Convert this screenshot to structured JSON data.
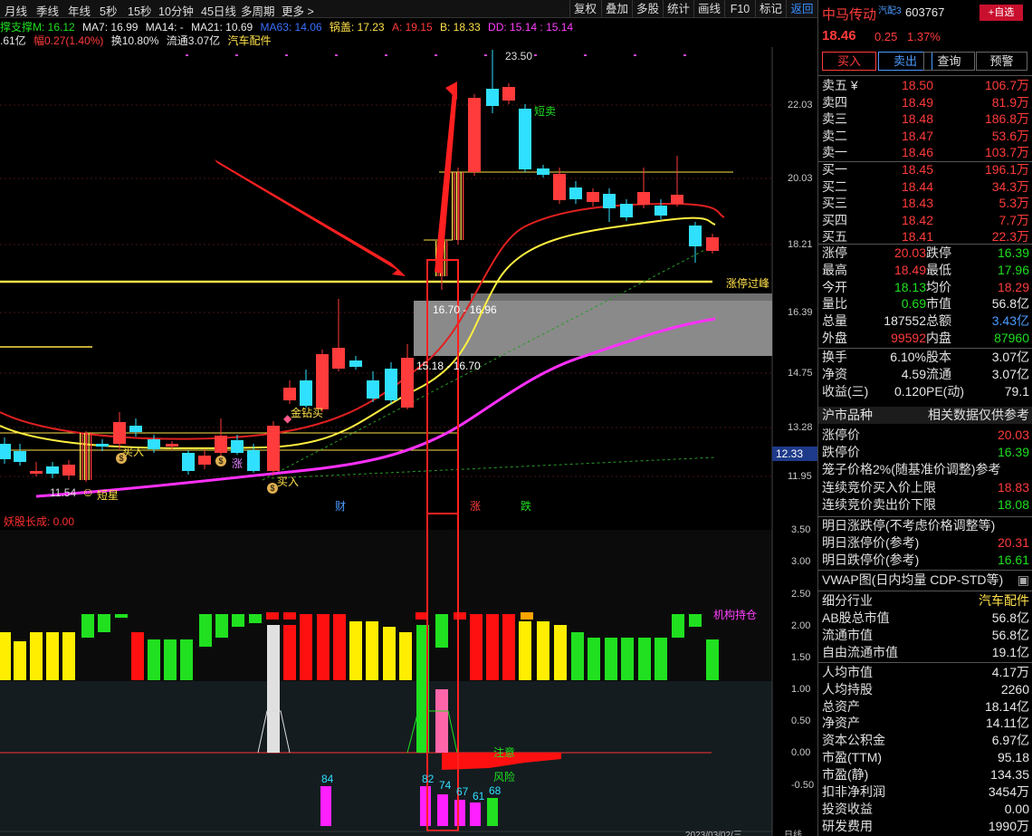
{
  "toolbar": {
    "periods": [
      "月线",
      "季线",
      "年线",
      "5秒",
      "15秒",
      "10分钟",
      "45日线",
      "多周期",
      "更多 >"
    ],
    "buttons": [
      "复权",
      "叠加",
      "多股",
      "统计",
      "画线",
      "F10",
      "标记",
      "返回"
    ]
  },
  "info_line1": {
    "support": "撑支撑M: 16.12",
    "ma7": "MA7: 16.99",
    "ma14": "MA14: -",
    "ma21": "MA21: 10.69",
    "ma63": "MA63: 14.06",
    "guogai": "锅盖: 17.23",
    "a": "A: 19.15",
    "b": "B: 18.33",
    "dd": "DD: 15.14 : 15.14"
  },
  "info_line2": {
    "cap": ".61亿",
    "amp": "幅0.27(1.40%)",
    "turnover": "换10.80%",
    "float": "流通3.07亿",
    "sector": "汽车配件"
  },
  "price_axis": [
    "22.03",
    "20.03",
    "18.21",
    "16.39",
    "14.75",
    "13.28",
    "11.95"
  ],
  "current_price_label": "12.33",
  "chart_labels": {
    "high": "23.50",
    "short_sell": "短卖",
    "limit_up_break": "涨停过峰",
    "zone_top": "16.70 - 16.96",
    "zone_bottom": "15.18 - 16.70",
    "gold_drill_buy": "金钻买",
    "buy1": "买入",
    "buy2": "买入",
    "rise": "涨",
    "low": "11.54",
    "low_tag": "短星",
    "cai": "财",
    "zhang": "涨",
    "die": "跌"
  },
  "indicator": {
    "title": "妖股长成: 0.00",
    "axis": [
      "3.50",
      "3.00",
      "2.50",
      "2.00",
      "1.50",
      "1.00",
      "0.50",
      "0.00",
      "-0.50"
    ],
    "inst_label": "机构持仓",
    "attention": "注意",
    "risk": "风险",
    "bar_labels": [
      "84",
      "82",
      "74",
      "67",
      "61",
      "68"
    ],
    "bottom_date": "2023/03/02/三",
    "bottom_right": "日线"
  },
  "right_panel": {
    "name": "中马传动",
    "sector_tag": "汽配3",
    "code": "603767",
    "add_fav": "+自选",
    "price": "18.46",
    "change": "0.25",
    "pct": "1.37%",
    "buttons": [
      "买入",
      "卖出",
      "查询",
      "预警"
    ],
    "asks": [
      {
        "label": "卖五 ¥",
        "price": "18.50",
        "vol": "106.7万"
      },
      {
        "label": "卖四",
        "price": "18.49",
        "vol": "81.9万"
      },
      {
        "label": "卖三",
        "price": "18.48",
        "vol": "186.8万"
      },
      {
        "label": "卖二",
        "price": "18.47",
        "vol": "53.6万"
      },
      {
        "label": "卖一",
        "price": "18.46",
        "vol": "103.7万"
      }
    ],
    "bids": [
      {
        "label": "买一",
        "price": "18.45",
        "vol": "196.1万"
      },
      {
        "label": "买二",
        "price": "18.44",
        "vol": "34.3万"
      },
      {
        "label": "买三",
        "price": "18.43",
        "vol": "5.3万"
      },
      {
        "label": "买四",
        "price": "18.42",
        "vol": "7.7万"
      },
      {
        "label": "买五",
        "price": "18.41",
        "vol": "22.3万"
      }
    ],
    "stats": [
      {
        "l1": "涨停",
        "v1": "20.03",
        "l2": "跌停",
        "v2": "16.39",
        "c1": "red",
        "c2": "green"
      },
      {
        "l1": "最高",
        "v1": "18.49",
        "l2": "最低",
        "v2": "17.96",
        "c1": "red",
        "c2": "green"
      },
      {
        "l1": "今开",
        "v1": "18.13",
        "l2": "均价",
        "v2": "18.29",
        "c1": "green",
        "c2": "red"
      },
      {
        "l1": "量比",
        "v1": "0.69",
        "l2": "市值",
        "v2": "56.8亿",
        "c1": "green",
        "c2": "white"
      },
      {
        "l1": "总量",
        "v1": "187552",
        "l2": "总额",
        "v2": "3.43亿",
        "c1": "white",
        "c2": "blue"
      },
      {
        "l1": "外盘",
        "v1": "99592",
        "l2": "内盘",
        "v2": "87960",
        "c1": "red",
        "c2": "green"
      }
    ],
    "stats2": [
      {
        "l1": "换手",
        "v1": "6.10%",
        "l2": "股本",
        "v2": "3.07亿"
      },
      {
        "l1": "净资",
        "v1": "4.59",
        "l2": "流通",
        "v2": "3.07亿"
      },
      {
        "l1": "收益(三)",
        "v1": "0.120",
        "l2": "PE(动)",
        "v2": "79.1"
      }
    ],
    "hushi_label": "沪市品种",
    "ref_label": "相关数据仅供参考",
    "limits": [
      {
        "l": "涨停价",
        "v": "20.03",
        "c": "red"
      },
      {
        "l": "跌停价",
        "v": "16.39",
        "c": "green"
      },
      {
        "l": "笼子价格2%(随基准价调整)参考",
        "v": "",
        "c": "white"
      },
      {
        "l": "连续竞价买入价上限",
        "v": "18.83",
        "c": "red"
      },
      {
        "l": "连续竞价卖出价下限",
        "v": "18.08",
        "c": "green"
      }
    ],
    "tomorrow": [
      {
        "l": "明日涨跌停(不考虑价格调整等)",
        "v": "",
        "c": "white"
      },
      {
        "l": "明日涨停价(参考)",
        "v": "20.31",
        "c": "red"
      },
      {
        "l": "明日跌停价(参考)",
        "v": "16.61",
        "c": "green"
      }
    ],
    "vwap": "VWAP图(日内均量 CDP-STD等)",
    "industry_label": "细分行业",
    "industry": "汽车配件",
    "fundamentals": [
      {
        "l": "AB股总市值",
        "v": "56.8亿"
      },
      {
        "l": "流通市值",
        "v": "56.8亿"
      },
      {
        "l": "自由流通市值",
        "v": "19.1亿"
      },
      {
        "l": "人均市值",
        "v": "4.17万"
      },
      {
        "l": "人均持股",
        "v": "2260"
      },
      {
        "l": "总资产",
        "v": "18.14亿"
      },
      {
        "l": "净资产",
        "v": "14.11亿"
      },
      {
        "l": "资本公积金",
        "v": "6.97亿"
      },
      {
        "l": "市盈(TTM)",
        "v": "95.18"
      },
      {
        "l": "市盈(静)",
        "v": "134.35"
      },
      {
        "l": "扣非净利润",
        "v": "3454万"
      },
      {
        "l": "投资收益",
        "v": "0.00"
      },
      {
        "l": "研发费用",
        "v": "1990万"
      }
    ]
  }
}
